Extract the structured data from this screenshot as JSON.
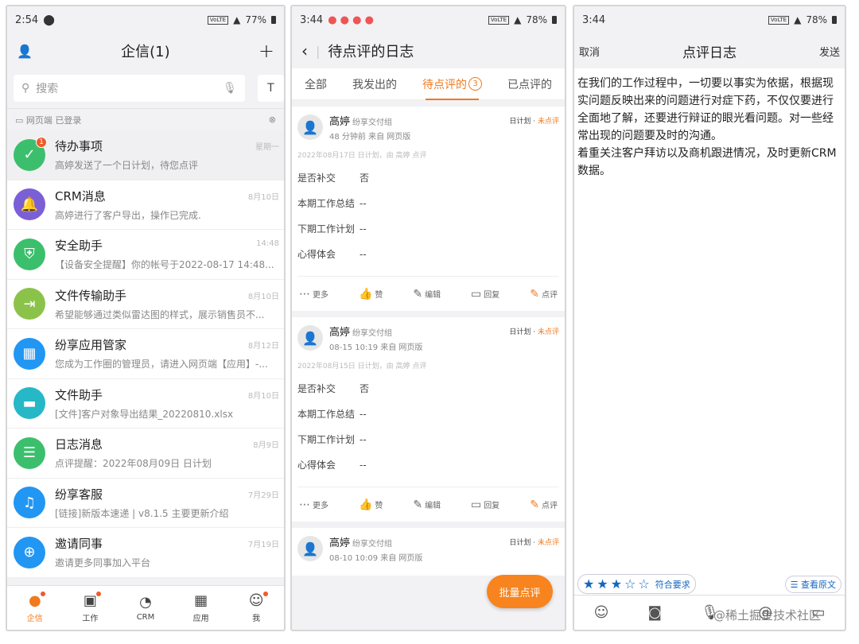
{
  "p1": {
    "status": {
      "time": "2:54",
      "net": "VoLTE",
      "battery": "77%"
    },
    "title": "企信(1)",
    "search": {
      "placeholder": "搜索"
    },
    "web_status": "网页端 已登录",
    "items": [
      {
        "name": "待办事项",
        "sub": "高婷发送了一个日计划，待您点评",
        "time": "星期一",
        "color": "#3cbf6c",
        "icon": "check-icon",
        "badge": "1"
      },
      {
        "name": "CRM消息",
        "sub": "高婷进行了客户导出，操作已完成.",
        "time": "8月10日",
        "color": "#7b5fd6",
        "icon": "bell-icon"
      },
      {
        "name": "安全助手",
        "sub": "【设备安全提醒】你的帐号于2022-08-17 14:48...",
        "time": "14:48",
        "color": "#3cbf6c",
        "icon": "shield-icon"
      },
      {
        "name": "文件传输助手",
        "sub": "希望能够通过类似雷达图的样式，展示销售员不...",
        "time": "8月10日",
        "color": "#8bc34a",
        "icon": "transfer-icon"
      },
      {
        "name": "纷享应用管家",
        "sub": "您成为工作圈的管理员，请进入网页端【应用】-...",
        "time": "8月12日",
        "color": "#2196f3",
        "icon": "grid-icon"
      },
      {
        "name": "文件助手",
        "sub": "[文件]客户对象导出结果_20220810.xlsx",
        "time": "8月10日",
        "color": "#26b8c6",
        "icon": "folder-icon"
      },
      {
        "name": "日志消息",
        "sub": "点评提醒：2022年08月09日 日计划",
        "time": "8月9日",
        "color": "#3cbf6c",
        "icon": "log-icon"
      },
      {
        "name": "纷享客服",
        "sub": "[链接]新版本速递 | v8.1.5 主要更新介绍",
        "time": "7月29日",
        "color": "#2196f3",
        "icon": "headset-icon"
      },
      {
        "name": "邀请同事",
        "sub": "邀请更多同事加入平台",
        "time": "7月19日",
        "color": "#2196f3",
        "icon": "add-user-icon"
      }
    ],
    "tabs": [
      {
        "label": "企信",
        "icon": "chat-icon",
        "badge": "1"
      },
      {
        "label": "工作",
        "icon": "briefcase-icon"
      },
      {
        "label": "CRM",
        "icon": "clock-icon"
      },
      {
        "label": "应用",
        "icon": "apps-icon"
      },
      {
        "label": "我",
        "icon": "person-icon"
      }
    ]
  },
  "p2": {
    "status": {
      "time": "3:44",
      "net": "VoLTE",
      "battery": "78%"
    },
    "title": "待点评的日志",
    "tabs": [
      {
        "label": "全部"
      },
      {
        "label": "我发出的"
      },
      {
        "label": "待点评的",
        "count": "3"
      },
      {
        "label": "已点评的"
      }
    ],
    "cards": [
      {
        "user": "高婷",
        "group": "纷享交付组",
        "meta": "48 分钟前 来自 网页版",
        "plan": "日计划",
        "status": "未点评",
        "date": "2022年08月17日 日计划，由 高婷 点评",
        "fields": [
          {
            "k": "是否补交",
            "v": "否"
          },
          {
            "k": "本期工作总结",
            "v": "--"
          },
          {
            "k": "下期工作计划",
            "v": "--"
          },
          {
            "k": "心得体会",
            "v": "--"
          }
        ]
      },
      {
        "user": "高婷",
        "group": "纷享交付组",
        "meta": "08-15 10:19 来自 网页版",
        "plan": "日计划",
        "status": "未点评",
        "date": "2022年08月15日 日计划，由 高婷 点评",
        "fields": [
          {
            "k": "是否补交",
            "v": "否"
          },
          {
            "k": "本期工作总结",
            "v": "--"
          },
          {
            "k": "下期工作计划",
            "v": "--"
          },
          {
            "k": "心得体会",
            "v": "--"
          }
        ]
      },
      {
        "user": "高婷",
        "group": "纷享交付组",
        "meta": "08-10 10:09 来自 网页版",
        "plan": "日计划",
        "status": "未点评"
      }
    ],
    "actions": {
      "more": "更多",
      "like": "赞",
      "edit": "编辑",
      "reply": "回复",
      "review": "点评"
    },
    "fab": "批量点评"
  },
  "p3": {
    "status": {
      "time": "3:44",
      "net": "VoLTE",
      "battery": "78%"
    },
    "cancel": "取消",
    "title": "点评日志",
    "send": "发送",
    "para1": "在我们的工作过程中，一切要以事实为依据，根据现实问题反映出来的问题进行对症下药，不仅仅要进行全面地了解，还要进行辩证的眼光看问题。对一些经常出现的问题要及时的沟通。",
    "para2": "着重关注客户拜访以及商机跟进情况，及时更新CRM数据。",
    "rating": {
      "value": 3,
      "max": 5,
      "label": "符合要求"
    },
    "view_original": "查看原文",
    "watermark": "@稀土掘金技术社区"
  }
}
